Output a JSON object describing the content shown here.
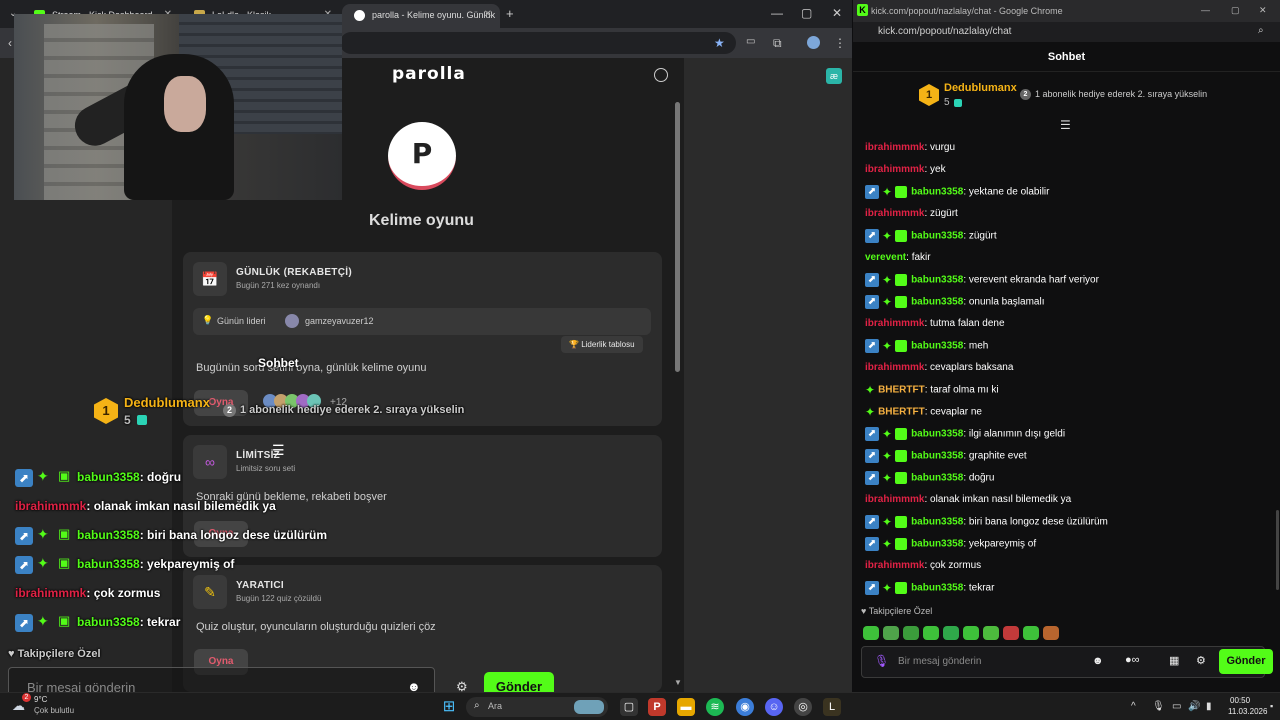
{
  "left_browser": {
    "tabs": [
      {
        "title": "Stream - Kick Dashboard"
      },
      {
        "title": "LoLdle - Klasik"
      },
      {
        "title": "parolla - Kelime oyunu. Günlük"
      }
    ],
    "new_tab": "+",
    "window_controls": [
      "—",
      "▢",
      "✕"
    ],
    "page": {
      "brand": "parolla",
      "avatar_letter": "P",
      "game_title": "Kelime oyunu",
      "daily": {
        "title": "GÜNLÜK (REKABETÇİ)",
        "subtitle": "Bugün 271 kez oynandı",
        "leader_label": "Günün lideri",
        "leader_name": "gamzeyavuzer12",
        "leaderboard_btn": "Liderlik tablosu",
        "description": "Bugünün soru setini oyna, günlük kelime oyunu",
        "play": "Oyna",
        "players_more": "+12"
      },
      "unlimited": {
        "title": "LİMİTSİZ",
        "subtitle": "Limitsiz soru seti",
        "description": "Sonraki günü bekleme, rekabeti boşver",
        "play": "Oyna"
      },
      "creator": {
        "title": "YARATICI",
        "subtitle": "Bugün 122 quiz çözüldü",
        "description": "Quiz oluştur, oyuncuların oluşturduğu quizleri çöz",
        "play": "Oyna"
      }
    },
    "overlay": {
      "header": "Sohbet",
      "top_user": "Dedublumanx",
      "top_rank": "1",
      "top_count": "5",
      "gift_rank": "2",
      "gift_text": "1 abonelik hediye ederek 2. sıraya yükselin",
      "messages": [
        {
          "user": "babun3358",
          "text": "doğru",
          "badges": true,
          "color": "green"
        },
        {
          "user": "ibrahimmmk",
          "text": "olanak imkan nasıl bilemedik ya",
          "badges": false,
          "color": "red"
        },
        {
          "user": "babun3358",
          "text": "biri bana longoz dese üzülürüm",
          "badges": true,
          "color": "green"
        },
        {
          "user": "babun3358",
          "text": "yekpareymiş of",
          "badges": true,
          "color": "green"
        },
        {
          "user": "ibrahimmmk",
          "text": "çok zormus",
          "badges": false,
          "color": "red"
        },
        {
          "user": "babun3358",
          "text": "tekrar",
          "badges": true,
          "color": "green"
        }
      ],
      "followers_only": "Takipçilere Özel",
      "input_placeholder": "Bir mesaj gönderin",
      "send": "Gönder"
    }
  },
  "right_window": {
    "title": "kick.com/popout/nazlalay/chat - Google Chrome",
    "url": "kick.com/popout/nazlalay/chat",
    "header": "Sohbet",
    "top_user": "Dedublumanx",
    "top_rank": "1",
    "top_count": "5",
    "gift_rank": "2",
    "gift_text": "1 abonelik hediye ederek 2. sıraya yükselin",
    "messages": [
      {
        "user": "ibrahimmmk",
        "text": "vurgu",
        "badges": "none",
        "color": "red"
      },
      {
        "user": "ibrahimmmk",
        "text": "yek",
        "badges": "none",
        "color": "red"
      },
      {
        "user": "babun3358",
        "text": "yektane de olabilir",
        "badges": "full",
        "color": "green"
      },
      {
        "user": "ibrahimmmk",
        "text": "zügürt",
        "badges": "none",
        "color": "red"
      },
      {
        "user": "babun3358",
        "text": "zügürt",
        "badges": "full",
        "color": "green"
      },
      {
        "user": "verevent",
        "text": "fakir",
        "badges": "none",
        "color": "green"
      },
      {
        "user": "babun3358",
        "text": "verevent ekranda harf veriyor",
        "badges": "full",
        "color": "green"
      },
      {
        "user": "babun3358",
        "text": "onunla başlamalı",
        "badges": "full",
        "color": "green"
      },
      {
        "user": "ibrahimmmk",
        "text": "tutma falan dene",
        "badges": "none",
        "color": "red"
      },
      {
        "user": "babun3358",
        "text": "meh",
        "badges": "full",
        "color": "green"
      },
      {
        "user": "ibrahimmmk",
        "text": "cevaplars baksana",
        "badges": "none",
        "color": "red"
      },
      {
        "user": "BHERTFT",
        "text": "taraf olma mı ki",
        "badges": "sparkle",
        "color": "orange"
      },
      {
        "user": "BHERTFT",
        "text": "cevaplar ne",
        "badges": "sparkle",
        "color": "orange"
      },
      {
        "user": "babun3358",
        "text": "ilgi alanımın dışı geldi",
        "badges": "full",
        "color": "green"
      },
      {
        "user": "babun3358",
        "text": "graphite evet",
        "badges": "full",
        "color": "green"
      },
      {
        "user": "babun3358",
        "text": "doğru",
        "badges": "full",
        "color": "green"
      },
      {
        "user": "ibrahimmmk",
        "text": "olanak imkan nasıl bilemedik ya",
        "badges": "none",
        "color": "red"
      },
      {
        "user": "babun3358",
        "text": "biri bana longoz dese üzülürüm",
        "badges": "full",
        "color": "green"
      },
      {
        "user": "babun3358",
        "text": "yekpareymiş of",
        "badges": "full",
        "color": "green"
      },
      {
        "user": "ibrahimmmk",
        "text": "çok zormus",
        "badges": "none",
        "color": "red"
      },
      {
        "user": "babun3358",
        "text": "tekrar",
        "badges": "full",
        "color": "green"
      }
    ],
    "followers_only": "Takipçilere Özel",
    "input_placeholder": "Bir mesaj gönderin",
    "send": "Gönder"
  },
  "taskbar": {
    "weather_temp": "9°C",
    "weather_desc": "Çok bulutlu",
    "weather_badge": "2",
    "search_label": "Ara",
    "time": "00:50",
    "date": "11.03.2026"
  },
  "colors": {
    "kick_green": "#53fc18",
    "username_red": "#e02245",
    "username_orange": "#f5b041",
    "rank_gold": "#f5b316",
    "badge_blue": "#3b82c4"
  }
}
